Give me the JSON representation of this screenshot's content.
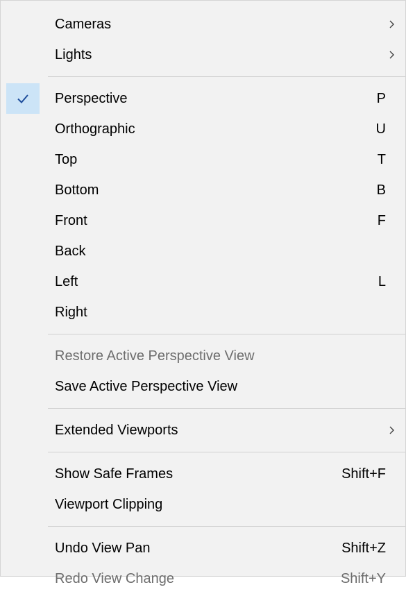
{
  "menu": {
    "items": [
      {
        "type": "item",
        "name": "menu-item-cameras",
        "label": "Cameras",
        "shortcut": "",
        "submenu": true,
        "checked": false,
        "disabled": false
      },
      {
        "type": "item",
        "name": "menu-item-lights",
        "label": "Lights",
        "shortcut": "",
        "submenu": true,
        "checked": false,
        "disabled": false
      },
      {
        "type": "separator"
      },
      {
        "type": "item",
        "name": "menu-item-perspective",
        "label": "Perspective",
        "shortcut": "P",
        "submenu": false,
        "checked": true,
        "disabled": false
      },
      {
        "type": "item",
        "name": "menu-item-orthographic",
        "label": "Orthographic",
        "shortcut": "U",
        "submenu": false,
        "checked": false,
        "disabled": false
      },
      {
        "type": "item",
        "name": "menu-item-top",
        "label": "Top",
        "shortcut": "T",
        "submenu": false,
        "checked": false,
        "disabled": false
      },
      {
        "type": "item",
        "name": "menu-item-bottom",
        "label": "Bottom",
        "shortcut": "B",
        "submenu": false,
        "checked": false,
        "disabled": false
      },
      {
        "type": "item",
        "name": "menu-item-front",
        "label": "Front",
        "shortcut": "F",
        "submenu": false,
        "checked": false,
        "disabled": false
      },
      {
        "type": "item",
        "name": "menu-item-back",
        "label": "Back",
        "shortcut": "",
        "submenu": false,
        "checked": false,
        "disabled": false
      },
      {
        "type": "item",
        "name": "menu-item-left",
        "label": "Left",
        "shortcut": "L",
        "submenu": false,
        "checked": false,
        "disabled": false
      },
      {
        "type": "item",
        "name": "menu-item-right",
        "label": "Right",
        "shortcut": "",
        "submenu": false,
        "checked": false,
        "disabled": false
      },
      {
        "type": "separator"
      },
      {
        "type": "item",
        "name": "menu-item-restore-active-perspective-view",
        "label": "Restore Active Perspective View",
        "shortcut": "",
        "submenu": false,
        "checked": false,
        "disabled": true
      },
      {
        "type": "item",
        "name": "menu-item-save-active-perspective-view",
        "label": "Save Active Perspective View",
        "shortcut": "",
        "submenu": false,
        "checked": false,
        "disabled": false
      },
      {
        "type": "separator"
      },
      {
        "type": "item",
        "name": "menu-item-extended-viewports",
        "label": "Extended Viewports",
        "shortcut": "",
        "submenu": true,
        "checked": false,
        "disabled": false
      },
      {
        "type": "separator"
      },
      {
        "type": "item",
        "name": "menu-item-show-safe-frames",
        "label": "Show Safe Frames",
        "shortcut": "Shift+F",
        "submenu": false,
        "checked": false,
        "disabled": false
      },
      {
        "type": "item",
        "name": "menu-item-viewport-clipping",
        "label": "Viewport Clipping",
        "shortcut": "",
        "submenu": false,
        "checked": false,
        "disabled": false
      },
      {
        "type": "separator"
      },
      {
        "type": "item",
        "name": "menu-item-undo-view-pan",
        "label": "Undo View Pan",
        "shortcut": "Shift+Z",
        "submenu": false,
        "checked": false,
        "disabled": false
      },
      {
        "type": "item",
        "name": "menu-item-redo-view-change",
        "label": "Redo View Change",
        "shortcut": "Shift+Y",
        "submenu": false,
        "checked": false,
        "disabled": true
      }
    ]
  },
  "icons": {
    "check": "checkmark-icon",
    "submenu": "chevron-right-icon"
  },
  "colors": {
    "menu_background": "#f2f2f2",
    "check_highlight": "#cce4f7",
    "check_mark": "#1f4e9c",
    "text": "#000000",
    "disabled_text": "#6d6d6d",
    "separator": "#cfcfcf"
  }
}
